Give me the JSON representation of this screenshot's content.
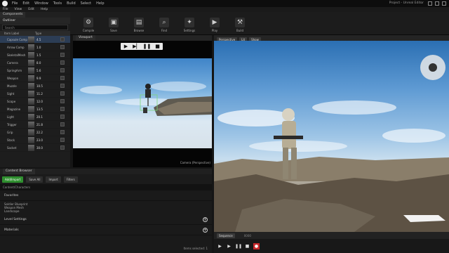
{
  "menubar": {
    "items": [
      "File",
      "Edit",
      "Window",
      "Tools",
      "Build",
      "Select",
      "Help"
    ],
    "title": "Project - Unreal Editor"
  },
  "menubar2": {
    "items": [
      "File",
      "View",
      "Edit",
      "Help"
    ]
  },
  "left_panel": {
    "tab": "Components",
    "title": "Outliner",
    "search_placeholder": "Search",
    "header": [
      "Item Label",
      "Type"
    ],
    "rows": [
      {
        "name": "Capsule Comp",
        "value": "4.5"
      },
      {
        "name": "Arrow Comp",
        "value": "1.0"
      },
      {
        "name": "SkeletalMesh",
        "value": "1.5"
      },
      {
        "name": "Camera",
        "value": "8.0"
      },
      {
        "name": "SpringArm",
        "value": "5.6"
      },
      {
        "name": "Weapon",
        "value": "9.9"
      },
      {
        "name": "Muzzle",
        "value": "10.5"
      },
      {
        "name": "Sight",
        "value": "11.2"
      },
      {
        "name": "Scope",
        "value": "12.0"
      },
      {
        "name": "Magazine",
        "value": "13.5"
      },
      {
        "name": "Light",
        "value": "20.1"
      },
      {
        "name": "Trigger",
        "value": "21.8"
      },
      {
        "name": "Grip",
        "value": "22.2"
      },
      {
        "name": "Stock",
        "value": "23.0"
      },
      {
        "name": "Socket",
        "value": "30.0"
      }
    ]
  },
  "toolbar": {
    "tools": [
      {
        "label": "Compile",
        "icon": "wrench-icon",
        "glyph": "⚙"
      },
      {
        "label": "Save",
        "icon": "save-icon",
        "glyph": "▣"
      },
      {
        "label": "Browse",
        "icon": "folder-icon",
        "glyph": "▤"
      },
      {
        "label": "Find",
        "icon": "search-icon",
        "glyph": "⌕"
      },
      {
        "label": "Settings",
        "icon": "gear-icon",
        "glyph": "✦"
      },
      {
        "label": "Play",
        "icon": "play-icon",
        "glyph": "▶"
      },
      {
        "label": "Build",
        "icon": "hammer-icon",
        "glyph": "⚒"
      }
    ]
  },
  "preview": {
    "tab": "Viewport",
    "caption": "Camera (Perspective)"
  },
  "viewport": {
    "tab": "Perspective",
    "buttons": [
      "Perspective",
      "Lit",
      "Show"
    ]
  },
  "content": {
    "tab": "Content Browser",
    "buttons": [
      "Add/Import",
      "Save All",
      "Import",
      "Filters"
    ],
    "path": "Content/Characters",
    "sections": [
      {
        "title": "Favorites",
        "lines": [
          "Soldier Blueprint",
          "Weapon Mesh",
          "Landscape"
        ]
      },
      {
        "title": "Level Settings",
        "lines": []
      },
      {
        "title": "Materials",
        "lines": []
      }
    ],
    "status": "Items selected: 1"
  },
  "sequencer": {
    "label": "Sequence",
    "timecode": "0000"
  }
}
